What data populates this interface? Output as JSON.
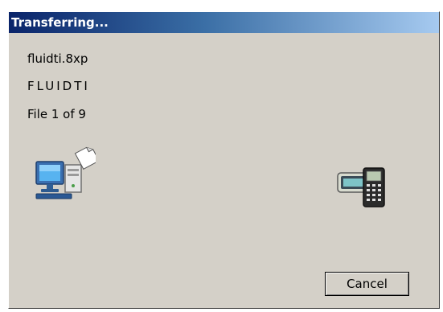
{
  "window": {
    "title": "Transferring..."
  },
  "transfer": {
    "filename": "fluidti.8xp",
    "variable_name": "FLUIDTI",
    "progress_text": "File 1 of 9"
  },
  "icons": {
    "source": "computer-icon",
    "flying_page": "document-page-icon",
    "destination": "calculator-device-icon"
  },
  "buttons": {
    "cancel_label": "Cancel"
  },
  "colors": {
    "title_gradient_start": "#0a246a",
    "title_gradient_end": "#a6caf0",
    "dialog_face": "#d4d0c8"
  }
}
